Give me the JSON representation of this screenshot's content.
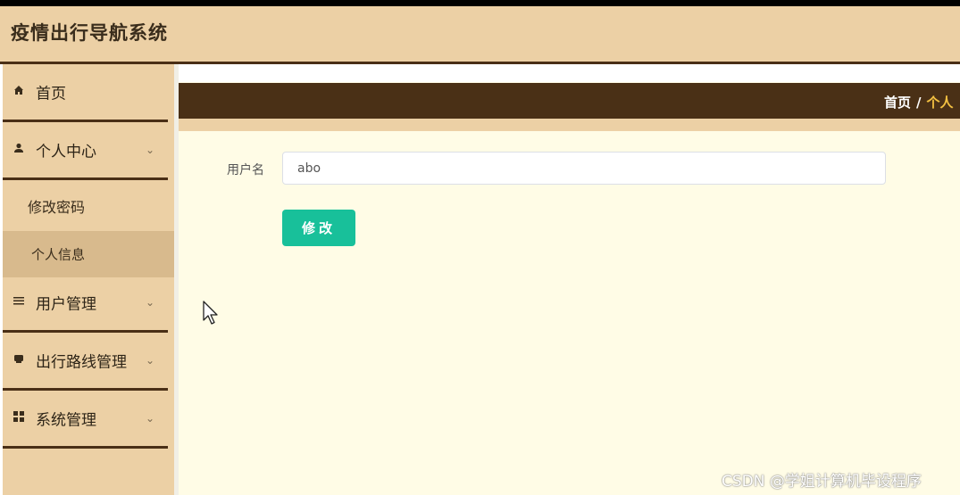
{
  "header": {
    "title": "疫情出行导航系统"
  },
  "sidebar": {
    "items": [
      {
        "icon": "home-icon",
        "label": "首页"
      },
      {
        "icon": "user-icon",
        "label": "个人中心",
        "expand": "⌄"
      },
      {
        "label": "修改密码"
      },
      {
        "label": "个人信息",
        "active": true
      },
      {
        "icon": "list-icon",
        "label": "用户管理",
        "expand": "⌄"
      },
      {
        "icon": "route-icon",
        "label": "出行路线管理",
        "expand": "⌄"
      },
      {
        "icon": "grid-icon",
        "label": "系统管理",
        "expand": "⌄"
      }
    ]
  },
  "breadcrumb": {
    "home": "首页",
    "separator": "/",
    "current": "个人"
  },
  "form": {
    "username_label": "用户名",
    "username_value": "abo",
    "submit_label": "修改"
  },
  "watermark": "CSDN @学姐计算机毕设程序",
  "colors": {
    "header_bg": "#ecd0a5",
    "crumb_bar": "#4a3016",
    "button": "#18c09a",
    "main_bg": "#fffce6",
    "active_sub": "#d8ba8d"
  }
}
